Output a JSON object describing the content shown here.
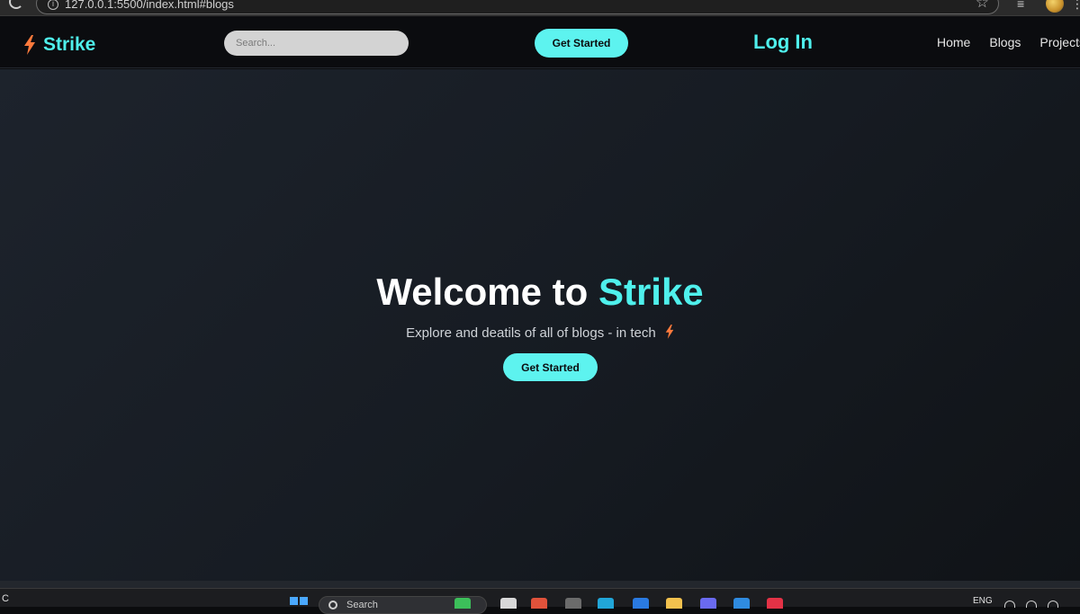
{
  "browser": {
    "url": "127.0.0.1:5500/index.html#blogs"
  },
  "navbar": {
    "logo_text": "Strike",
    "search_placeholder": "Search...",
    "get_started_label": "Get Started",
    "login_label": "Log In",
    "links": [
      "Home",
      "Blogs",
      "Projects"
    ]
  },
  "hero": {
    "title_prefix": "Welcome to ",
    "title_accent": "Strike",
    "subtitle": "Explore and deatils of all of blogs - in tech",
    "cta_label": "Get Started"
  },
  "taskbar": {
    "weather_text": "C",
    "search_label": "Search",
    "language": "ENG"
  },
  "colors": {
    "accent": "#4ff0ec",
    "button_bg": "#5df3ef",
    "bolt": "#ff7a3c",
    "navbar_bg": "#0b0c0f",
    "hero_bg": "#1a1f27"
  }
}
